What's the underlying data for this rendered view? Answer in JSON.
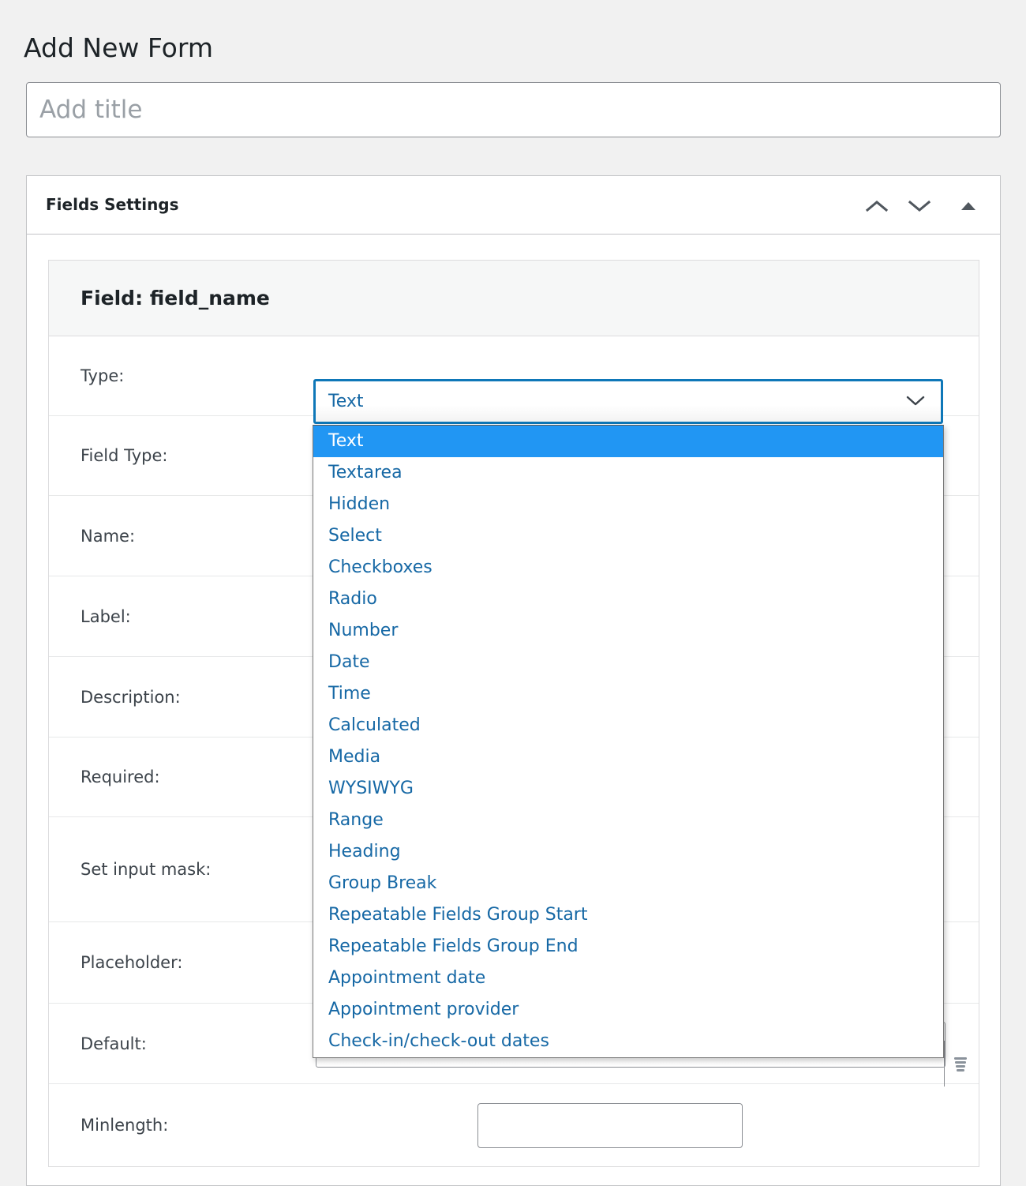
{
  "page": {
    "title": "Add New Form"
  },
  "title_input": {
    "value": "",
    "placeholder": "Add title"
  },
  "metabox": {
    "title": "Fields Settings",
    "controls": {
      "order_up": "chevron-up-icon",
      "order_down": "chevron-down-icon",
      "toggle": "triangle-up-icon"
    }
  },
  "field_box": {
    "title": "Field: field_name",
    "rows": [
      {
        "label": "Type:"
      },
      {
        "label": "Field Type:"
      },
      {
        "label": "Name:"
      },
      {
        "label": "Label:"
      },
      {
        "label": "Description:"
      },
      {
        "label": "Required:"
      },
      {
        "label": "Set input mask:"
      },
      {
        "label": "Placeholder:"
      },
      {
        "label": "Default:"
      },
      {
        "label": "Minlength:"
      }
    ]
  },
  "type_select": {
    "value": "Text",
    "expanded": true,
    "chevron": "chevron-down-icon",
    "options": [
      "Text",
      "Textarea",
      "Hidden",
      "Select",
      "Checkboxes",
      "Radio",
      "Number",
      "Date",
      "Time",
      "Calculated",
      "Media",
      "WYSIWYG",
      "Range",
      "Heading",
      "Group Break",
      "Repeatable Fields Group Start",
      "Repeatable Fields Group End",
      "Appointment date",
      "Appointment provider",
      "Check-in/check-out dates"
    ],
    "selected_index": 0
  },
  "default_field": {
    "value": "",
    "placeholder": "",
    "grip": "resize-grip-icon"
  },
  "minlength_field": {
    "value": "",
    "placeholder": ""
  },
  "colors": {
    "page_background": "#f1f1f1",
    "panel_background": "#ffffff",
    "panel_border": "#c3c4c7",
    "row_divider": "#e7e8e9",
    "text_primary": "#1d2327",
    "text_secondary": "#3c434a",
    "link_blue": "#1668a5",
    "select_focus_border": "#0e77b8",
    "option_highlight": "#2196f3",
    "field_header_background": "#f6f7f7"
  }
}
